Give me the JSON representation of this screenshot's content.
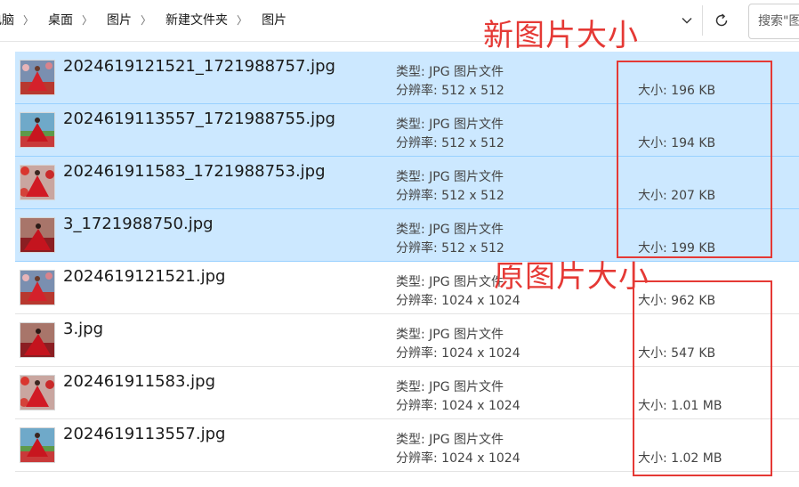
{
  "breadcrumb": [
    "电脑",
    "桌面",
    "图片",
    "新建文件夹",
    "图片"
  ],
  "search": {
    "placeholder": "搜索\"图"
  },
  "labels": {
    "type_prefix": "类型: ",
    "res_prefix": "分辨率: ",
    "size_prefix": "大小: "
  },
  "annotations": {
    "new_size": "新图片大小",
    "orig_size": "原图片大小",
    "color": "#e53935"
  },
  "colors": {
    "selected_bg": "#cce8ff",
    "accent": "#e53935"
  },
  "files": [
    {
      "name": "2024619121521_1721988757.jpg",
      "type": "JPG 图片文件",
      "resolution": "512 x 512",
      "size": "196 KB",
      "selected": true,
      "thumb": "red-dress-woman"
    },
    {
      "name": "2024619113557_1721988755.jpg",
      "type": "JPG 图片文件",
      "resolution": "512 x 512",
      "size": "194 KB",
      "selected": true,
      "thumb": "red-dress-woman"
    },
    {
      "name": "202461911583_1721988753.jpg",
      "type": "JPG 图片文件",
      "resolution": "512 x 512",
      "size": "207 KB",
      "selected": true,
      "thumb": "red-dress-woman"
    },
    {
      "name": "3_1721988750.jpg",
      "type": "JPG 图片文件",
      "resolution": "512 x 512",
      "size": "199 KB",
      "selected": true,
      "thumb": "red-dress-woman"
    },
    {
      "name": "2024619121521.jpg",
      "type": "JPG 图片文件",
      "resolution": "1024 x 1024",
      "size": "962 KB",
      "selected": false,
      "thumb": "red-dress-woman"
    },
    {
      "name": "3.jpg",
      "type": "JPG 图片文件",
      "resolution": "1024 x 1024",
      "size": "547 KB",
      "selected": false,
      "thumb": "red-dress-woman"
    },
    {
      "name": "202461911583.jpg",
      "type": "JPG 图片文件",
      "resolution": "1024 x 1024",
      "size": "1.01 MB",
      "selected": false,
      "thumb": "red-dress-woman"
    },
    {
      "name": "2024619113557.jpg",
      "type": "JPG 图片文件",
      "resolution": "1024 x 1024",
      "size": "1.02 MB",
      "selected": false,
      "thumb": "red-dress-woman"
    }
  ]
}
